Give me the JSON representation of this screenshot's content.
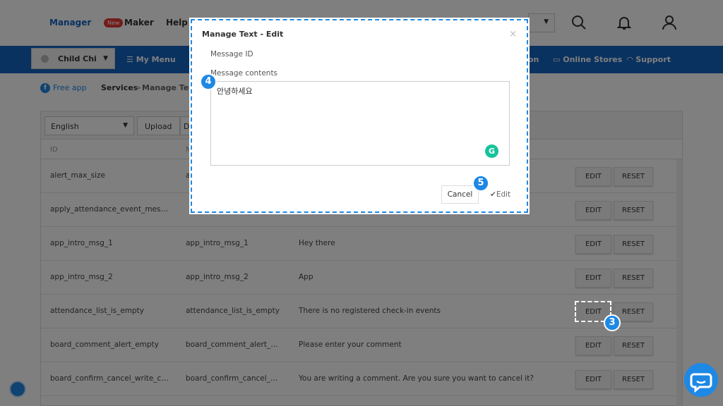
{
  "header": {
    "manager": "Manager",
    "new_badge": "New",
    "maker": "Maker",
    "help": "Help"
  },
  "nav": {
    "app_select": "Child Chi",
    "items": [
      "My Menu",
      "on",
      "Online Stores",
      "Support"
    ]
  },
  "breadcrumb": {
    "root": "Free app",
    "services": "Services",
    "separator": ">",
    "current": "Manage Text"
  },
  "toolbar": {
    "language": "English",
    "upload": "Upload",
    "download_partial": "D"
  },
  "table": {
    "columns": [
      "ID",
      "N"
    ],
    "rows": [
      {
        "id": "alert_max_size",
        "name": "a",
        "text": ""
      },
      {
        "id": "apply_attendance_event_message",
        "name": "",
        "text": ""
      },
      {
        "id": "app_intro_msg_1",
        "name": "app_intro_msg_1",
        "text": "Hey there"
      },
      {
        "id": "app_intro_msg_2",
        "name": "app_intro_msg_2",
        "text": "App"
      },
      {
        "id": "attendance_list_is_empty",
        "name": "attendance_list_is_empty",
        "text": "There is no registered check-in events"
      },
      {
        "id": "board_comment_alert_empty",
        "name": "board_comment_alert_e...",
        "text": "Please enter your comment"
      },
      {
        "id": "board_confirm_cancel_write_co...",
        "name": "board_confirm_cancel_wr...",
        "text": "You are writing a comment. Are you sure you want to cancel it?"
      }
    ],
    "edit_label": "EDIT",
    "reset_label": "RESET"
  },
  "modal": {
    "title": "Manage Text - Edit",
    "close": "×",
    "message_id_label": "Message ID",
    "message_contents_label": "Message contents",
    "message_contents_value": "안녕하세요",
    "cancel": "Cancel",
    "edit": "Edit"
  },
  "steps": {
    "three": "3",
    "four": "4",
    "five": "5"
  },
  "colors": {
    "primary": "#1565c0",
    "accent": "#1e88e5",
    "grammarly": "#15c39a"
  }
}
